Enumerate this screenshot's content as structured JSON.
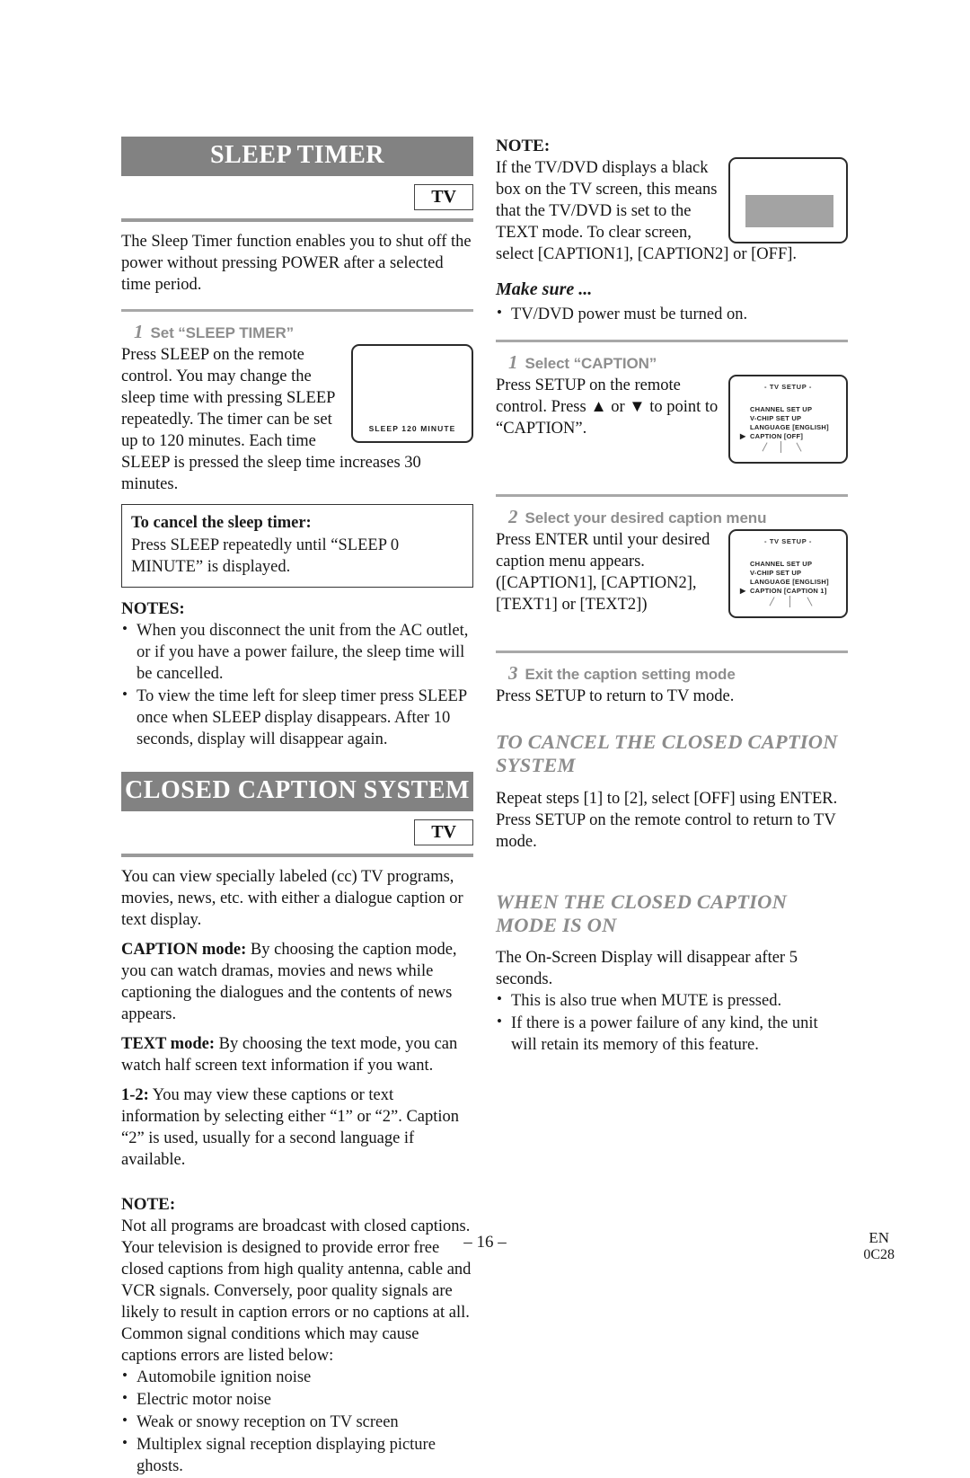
{
  "document": {
    "page_number": "– 16 –",
    "lang_code": "EN",
    "doc_code": "0C28"
  },
  "left_column": {
    "section1": {
      "banner_title": "SLEEP TIMER",
      "tv_badge": "TV",
      "intro": "The Sleep Timer function enables you to shut off the power without pressing POWER after a selected time period.",
      "step1": {
        "number": "1",
        "label": "Set “SLEEP TIMER”",
        "body": "Press SLEEP on the remote control. You may change the sleep time with pressing SLEEP repeatedly. The timer can be set up to 120 minutes. Each time SLEEP is pressed the sleep time increases 30 minutes.",
        "tv_osd": "SLEEP  120  MINUTE"
      },
      "cancel_box": {
        "title": "To cancel the sleep timer:",
        "body": "Press SLEEP repeatedly until “SLEEP 0 MINUTE” is displayed."
      },
      "notes_head": "NOTES:",
      "notes": [
        "When you disconnect the unit from the AC outlet, or if you have a power failure, the sleep time will be cancelled.",
        "To view the time left for sleep timer press SLEEP once when SLEEP display disappears. After 10 seconds, display will disappear again."
      ]
    },
    "section2": {
      "banner_title": "CLOSED CAPTION SYSTEM",
      "tv_badge": "TV",
      "intro": "You can view specially labeled (cc) TV programs, movies, news, etc. with either a dialogue caption or text display.",
      "caption_mode_label": "CAPTION mode:",
      "caption_mode_body": " By choosing the caption mode, you can watch dramas, movies and news while captioning the dialogues and the contents of news appears.",
      "text_mode_label": "TEXT mode:",
      "text_mode_body": " By choosing the text mode, you can watch half screen text information if you want.",
      "one_two_label": "1-2:",
      "one_two_body": " You may view these captions or text information by selecting either “1” or “2”. Caption “2” is used, usually for a second language if available.",
      "note_head": "NOTE:",
      "note_body": "Not all programs are broadcast with closed captions. Your television is designed to provide error free closed captions from high quality antenna, cable and VCR signals. Conversely, poor quality signals are likely to result in caption errors or no captions at all. Common signal conditions which may cause captions errors are listed below:",
      "note_bullets": [
        "Automobile ignition noise",
        "Electric motor noise",
        "Weak or snowy reception on TV screen",
        "Multiplex signal reception displaying picture ghosts."
      ]
    }
  },
  "right_column": {
    "note": {
      "head": "NOTE:",
      "body": "If the TV/DVD displays a black box on the TV screen, this means that the TV/DVD is set to the TEXT mode. To clear screen, select [CAPTION1], [CAPTION2] or [OFF]."
    },
    "make_sure": {
      "head": "Make sure ...",
      "bullets": [
        "TV/DVD power must be turned on."
      ]
    },
    "step1": {
      "number": "1",
      "label": "Select “CAPTION”",
      "body": "Press SETUP on the remote control. Press ▲ or ▼ to point to “CAPTION”.",
      "menu": {
        "title": "- TV SETUP -",
        "items": [
          "CHANNEL SET UP",
          "V-CHIP SET UP",
          "LANGUAGE  [ENGLISH]",
          "CAPTION  [OFF]"
        ],
        "cursor": "▶",
        "cursor_row": 3
      }
    },
    "step2": {
      "number": "2",
      "label": "Select your desired caption menu",
      "body": "Press ENTER until your desired caption menu appears. ([CAPTION1], [CAPTION2], [TEXT1] or [TEXT2])",
      "menu": {
        "title": "- TV SETUP -",
        "items": [
          "CHANNEL SET UP",
          "V-CHIP SET UP",
          "LANGUAGE  [ENGLISH]",
          "CAPTION  [CAPTION 1]"
        ],
        "cursor": "▶",
        "cursor_row": 3
      }
    },
    "step3": {
      "number": "3",
      "label": "Exit the caption setting mode",
      "body": "Press SETUP to return to TV mode."
    },
    "cancel_section": {
      "head": "TO CANCEL THE CLOSED CAPTION SYSTEM",
      "body": "Repeat steps [1] to [2], select [OFF] using ENTER. Press SETUP on the remote control to return to TV mode."
    },
    "when_on_section": {
      "head": "WHEN THE CLOSED CAPTION MODE IS ON",
      "body": "The On-Screen Display will disappear after 5 seconds.",
      "bullets": [
        "This is also true when MUTE is pressed.",
        "If there is a power failure of any kind, the unit will retain its memory of this feature."
      ]
    }
  }
}
